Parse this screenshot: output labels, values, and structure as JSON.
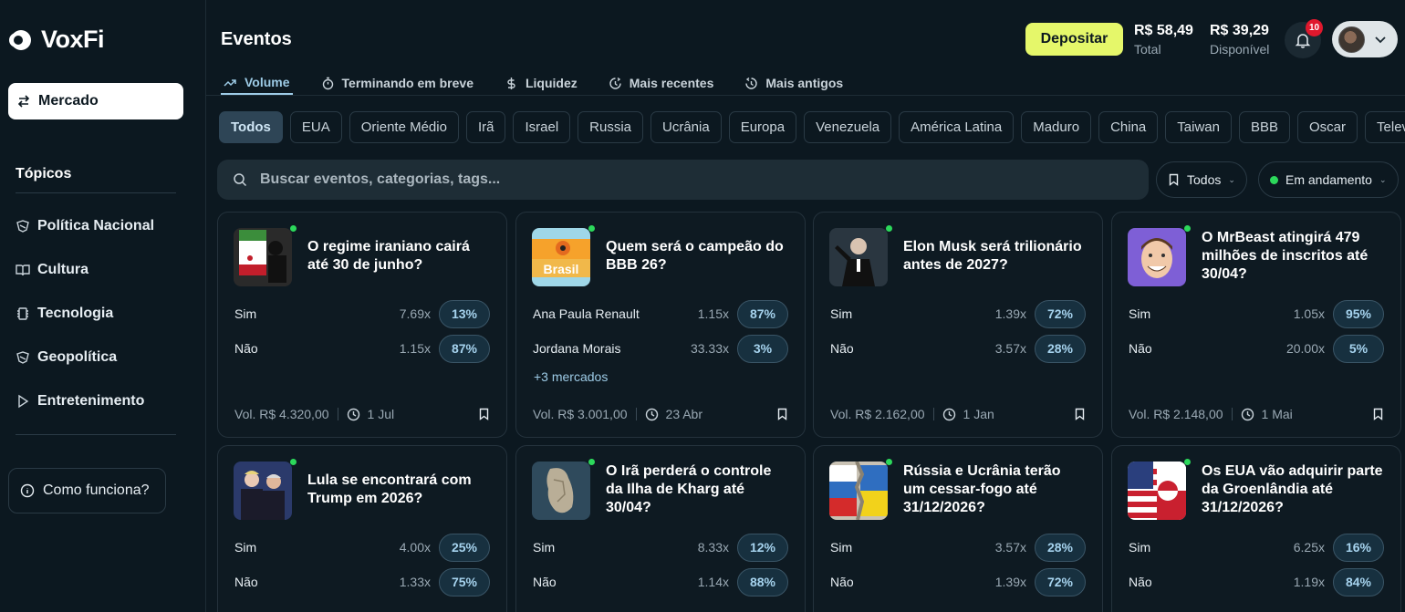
{
  "brand": {
    "name": "VoxFi"
  },
  "sidebar": {
    "market_label": "Mercado",
    "topics_title": "Tópicos",
    "topics": [
      {
        "label": "Política Nacional",
        "icon": "shield-icon"
      },
      {
        "label": "Cultura",
        "icon": "book-icon"
      },
      {
        "label": "Tecnologia",
        "icon": "chip-icon"
      },
      {
        "label": "Geopolítica",
        "icon": "shield-icon"
      },
      {
        "label": "Entretenimento",
        "icon": "play-icon"
      }
    ],
    "how_label": "Como funciona?"
  },
  "header": {
    "title": "Eventos",
    "deposit_label": "Depositar",
    "total_amount": "R$ 58,49",
    "total_label": "Total",
    "available_amount": "R$ 39,29",
    "available_label": "Disponível",
    "notifications_count": "10"
  },
  "sort_tabs": [
    {
      "label": "Volume",
      "icon": "trending-icon",
      "active": true
    },
    {
      "label": "Terminando em breve",
      "icon": "timer-icon"
    },
    {
      "label": "Liquidez",
      "icon": "dollar-icon"
    },
    {
      "label": "Mais recentes",
      "icon": "clock-forward-icon"
    },
    {
      "label": "Mais antigos",
      "icon": "clock-back-icon"
    }
  ],
  "categories": [
    "Todos",
    "EUA",
    "Oriente Médio",
    "Irã",
    "Israel",
    "Russia",
    "Ucrânia",
    "Europa",
    "Venezuela",
    "América Latina",
    "Maduro",
    "China",
    "Taiwan",
    "BBB",
    "Oscar",
    "Televi"
  ],
  "search": {
    "placeholder": "Buscar eventos, categorias, tags..."
  },
  "filters": {
    "saved_label": "Todos",
    "status_label": "Em andamento"
  },
  "events": [
    {
      "question": "O regime iraniano cairá até 30 de junho?",
      "outcomes": [
        {
          "name": "Sim",
          "mult": "7.69x",
          "pct": "13%"
        },
        {
          "name": "Não",
          "mult": "1.15x",
          "pct": "87%"
        }
      ],
      "volume": "Vol. R$ 4.320,00",
      "date": "1 Jul",
      "colors": [
        "#ffffff",
        "#c21e2b",
        "#1d1d1d"
      ]
    },
    {
      "question": "Quem será o campeão do BBB 26?",
      "outcomes": [
        {
          "name": "Ana Paula Renault",
          "mult": "1.15x",
          "pct": "87%"
        },
        {
          "name": "Jordana Morais",
          "mult": "33.33x",
          "pct": "3%"
        }
      ],
      "more": "+3 mercados",
      "volume": "Vol. R$ 3.001,00",
      "date": "23 Abr",
      "colors": [
        "#f6a22b",
        "#9fd7e8",
        "#ffffff"
      ]
    },
    {
      "question": "Elon Musk será trilionário antes de 2027?",
      "outcomes": [
        {
          "name": "Sim",
          "mult": "1.39x",
          "pct": "72%"
        },
        {
          "name": "Não",
          "mult": "3.57x",
          "pct": "28%"
        }
      ],
      "volume": "Vol. R$ 2.162,00",
      "date": "1 Jan",
      "colors": [
        "#2a3640",
        "#111111",
        "#d9c3b1"
      ]
    },
    {
      "question": "O MrBeast atingirá 479 milhões de inscritos até 30/04?",
      "outcomes": [
        {
          "name": "Sim",
          "mult": "1.05x",
          "pct": "95%"
        },
        {
          "name": "Não",
          "mult": "20.00x",
          "pct": "5%"
        }
      ],
      "volume": "Vol. R$ 2.148,00",
      "date": "1 Mai",
      "colors": [
        "#7e5fd6",
        "#f1c9a9",
        "#5b3a22"
      ]
    },
    {
      "question": "Lula se encontrará com Trump em 2026?",
      "outcomes": [
        {
          "name": "Sim",
          "mult": "4.00x",
          "pct": "25%"
        },
        {
          "name": "Não",
          "mult": "1.33x",
          "pct": "75%"
        }
      ],
      "colors": [
        "#2b3a6b",
        "#e9c9b4",
        "#1b1b2a"
      ]
    },
    {
      "question": "O Irã perderá o controle da Ilha de Kharg até 30/04?",
      "outcomes": [
        {
          "name": "Sim",
          "mult": "8.33x",
          "pct": "12%"
        },
        {
          "name": "Não",
          "mult": "1.14x",
          "pct": "88%"
        }
      ],
      "colors": [
        "#2f4a5c",
        "#b9ae97",
        "#1f3544"
      ]
    },
    {
      "question": "Rússia e Ucrânia terão um cessar-fogo até 31/12/2026?",
      "outcomes": [
        {
          "name": "Sim",
          "mult": "3.57x",
          "pct": "28%"
        },
        {
          "name": "Não",
          "mult": "1.39x",
          "pct": "72%"
        }
      ],
      "colors": [
        "#f2d21b",
        "#2f6ec0",
        "#d42b2b"
      ]
    },
    {
      "question": "Os EUA vão adquirir parte da Groenlândia até 31/12/2026?",
      "outcomes": [
        {
          "name": "Sim",
          "mult": "6.25x",
          "pct": "16%"
        },
        {
          "name": "Não",
          "mult": "1.19x",
          "pct": "84%"
        }
      ],
      "colors": [
        "#c9202f",
        "#ffffff",
        "#2a3f7d"
      ]
    }
  ]
}
